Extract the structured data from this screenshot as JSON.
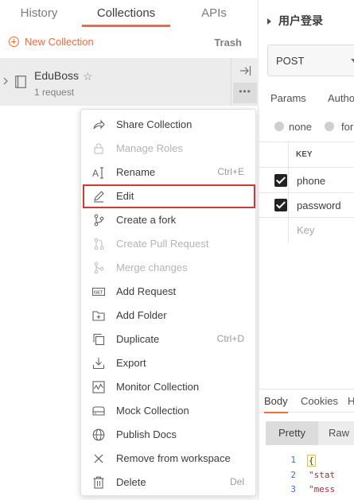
{
  "sidebar": {
    "tabs": [
      {
        "label": "History"
      },
      {
        "label": "Collections"
      },
      {
        "label": "APIs"
      }
    ],
    "new_collection_label": "New Collection",
    "trash_label": "Trash",
    "collection": {
      "name": "EduBoss",
      "request_count": "1 request",
      "more_label": "•••"
    }
  },
  "context_menu": {
    "items": [
      {
        "label": "Share Collection",
        "icon": "share-icon",
        "shortcut": "",
        "disabled": false
      },
      {
        "label": "Manage Roles",
        "icon": "lock-icon",
        "shortcut": "",
        "disabled": true
      },
      {
        "label": "Rename",
        "icon": "rename-icon",
        "shortcut": "Ctrl+E",
        "disabled": false
      },
      {
        "label": "Edit",
        "icon": "pencil-icon",
        "shortcut": "",
        "disabled": false,
        "highlighted": true
      },
      {
        "label": "Create a fork",
        "icon": "fork-icon",
        "shortcut": "",
        "disabled": false
      },
      {
        "label": "Create Pull Request",
        "icon": "pull-request-icon",
        "shortcut": "",
        "disabled": true
      },
      {
        "label": "Merge changes",
        "icon": "merge-icon",
        "shortcut": "",
        "disabled": true
      },
      {
        "label": "Add Request",
        "icon": "get-request-icon",
        "shortcut": "",
        "disabled": false
      },
      {
        "label": "Add Folder",
        "icon": "add-folder-icon",
        "shortcut": "",
        "disabled": false
      },
      {
        "label": "Duplicate",
        "icon": "duplicate-icon",
        "shortcut": "Ctrl+D",
        "disabled": false
      },
      {
        "label": "Export",
        "icon": "export-icon",
        "shortcut": "",
        "disabled": false
      },
      {
        "label": "Monitor Collection",
        "icon": "monitor-icon",
        "shortcut": "",
        "disabled": false
      },
      {
        "label": "Mock Collection",
        "icon": "mock-server-icon",
        "shortcut": "",
        "disabled": false
      },
      {
        "label": "Publish Docs",
        "icon": "globe-icon",
        "shortcut": "",
        "disabled": false
      },
      {
        "label": "Remove from workspace",
        "icon": "close-icon",
        "shortcut": "",
        "disabled": false
      },
      {
        "label": "Delete",
        "icon": "trash-icon",
        "shortcut": "Del",
        "disabled": false
      }
    ]
  },
  "request": {
    "title": "用户登录",
    "method": "POST",
    "tabs": [
      "Params",
      "Autho"
    ],
    "body_types": [
      "none",
      "for"
    ],
    "table_header": "KEY",
    "rows": [
      {
        "key": "phone"
      },
      {
        "key": "password"
      }
    ],
    "new_key_placeholder": "Key"
  },
  "response": {
    "tabs": [
      "Body",
      "Cookies",
      "H"
    ],
    "format_options": [
      "Pretty",
      "Raw"
    ],
    "code_lines": [
      {
        "num": "1",
        "text": "{"
      },
      {
        "num": "2",
        "text": "\"stat"
      },
      {
        "num": "3",
        "text": "\"mess"
      }
    ]
  },
  "colors": {
    "accent": "#f26b3a",
    "highlight_outline": "#d2383a",
    "hover_background": "#ececec"
  }
}
